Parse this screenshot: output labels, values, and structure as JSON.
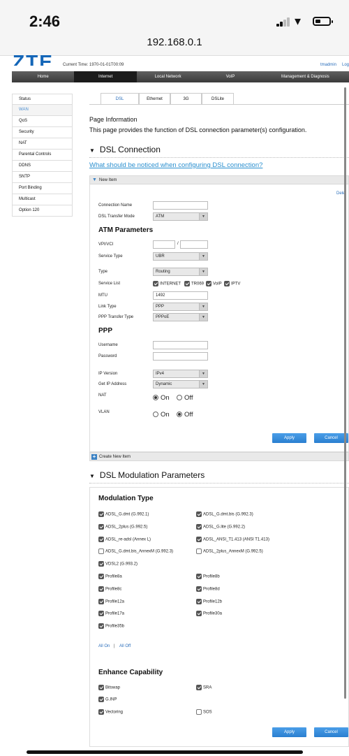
{
  "status": {
    "time": "2:46",
    "url": "192.168.0.1"
  },
  "header": {
    "logo": "ZTE",
    "current_time": "Current Time: 1970-01-01T00:09",
    "user": "tmadmin",
    "logout": "Log"
  },
  "topnav": [
    "Home",
    "Internet",
    "Local Network",
    "VoIP",
    "Management & Diagnosis"
  ],
  "sidebar": [
    "Status",
    "WAN",
    "QoS",
    "Security",
    "NAT",
    "Parental Controls",
    "DDNS",
    "SNTP",
    "Port Binding",
    "Multicast",
    "Option 120"
  ],
  "subtabs": [
    "DSL",
    "Ethernet",
    "3G",
    "DSLite"
  ],
  "page_info": {
    "title": "Page Information",
    "desc": "This page provides the function of DSL connection parameter(s) configuration."
  },
  "dsl_connection": {
    "title": "DSL Connection",
    "notice": "What should be noticed when configuring DSL connection?",
    "new_item": "New Item",
    "delete": "Delet",
    "connection_name_label": "Connection Name",
    "connection_name": "",
    "transfer_mode_label": "DSL Transfer Mode",
    "transfer_mode": "ATM",
    "atm_title": "ATM Parameters",
    "vpi_label": "VPI/VCI",
    "vpi_sep": "/",
    "service_type_label": "Service Type",
    "service_type": "UBR",
    "type_label": "Type",
    "type": "Routing",
    "service_list_label": "Service List",
    "service_list": [
      "INTERNET",
      "TR069",
      "VoIP",
      "IPTV"
    ],
    "mtu_label": "MTU",
    "mtu": "1492",
    "link_type_label": "Link Type",
    "link_type": "PPP",
    "ppp_transfer_label": "PPP Transfer Type",
    "ppp_transfer": "PPPoE",
    "ppp_title": "PPP",
    "username_label": "Username",
    "password_label": "Password",
    "ip_version_label": "IP Version",
    "ip_version": "IPv4",
    "get_ip_label": "Get IP Address",
    "get_ip": "Dynamic",
    "nat_label": "NAT",
    "vlan_label": "VLAN",
    "on": "On",
    "off": "Off",
    "apply": "Apply",
    "cancel": "Cancel",
    "create_new": "Create New Item"
  },
  "modulation": {
    "title": "DSL Modulation Parameters",
    "type_title": "Modulation Type",
    "left": [
      {
        "label": "ADSL_G.dmt (G.992.1)",
        "checked": true
      },
      {
        "label": "ADSL_2plus (G.992.5)",
        "checked": true
      },
      {
        "label": "ADSL_re-adsl (Annex L)",
        "checked": true
      },
      {
        "label": "ADSL_G.dmt.bis_AnnexM (G.992.3)",
        "checked": false
      },
      {
        "label": "VDSL2 (G.993.2)",
        "checked": true
      }
    ],
    "right": [
      {
        "label": "ADSL_G.dmt.bis (G.992.3)",
        "checked": true
      },
      {
        "label": "ADSL_G.lite (G.992.2)",
        "checked": true
      },
      {
        "label": "ADSL_ANSI_T1.413 (ANSI T1.413)",
        "checked": true
      },
      {
        "label": "ADSL_2plus_AnnexM (G.992.5)",
        "checked": false
      }
    ],
    "profiles_left": [
      "Profile8a",
      "Profile8c",
      "Profile12a",
      "Profile17a",
      "Profile35b"
    ],
    "profiles_right": [
      "Profile8b",
      "Profile8d",
      "Profile12b",
      "Profile30a"
    ],
    "all_on": "All On",
    "sep": "|",
    "all_off": "All Off",
    "enhance_title": "Enhance Capability",
    "bitswap": "Bitswap",
    "sra": "SRA",
    "ginp": "G.INP",
    "vectoring": "Vectoring",
    "sos": "SOS",
    "apply": "Apply",
    "cancel": "Cancel"
  }
}
